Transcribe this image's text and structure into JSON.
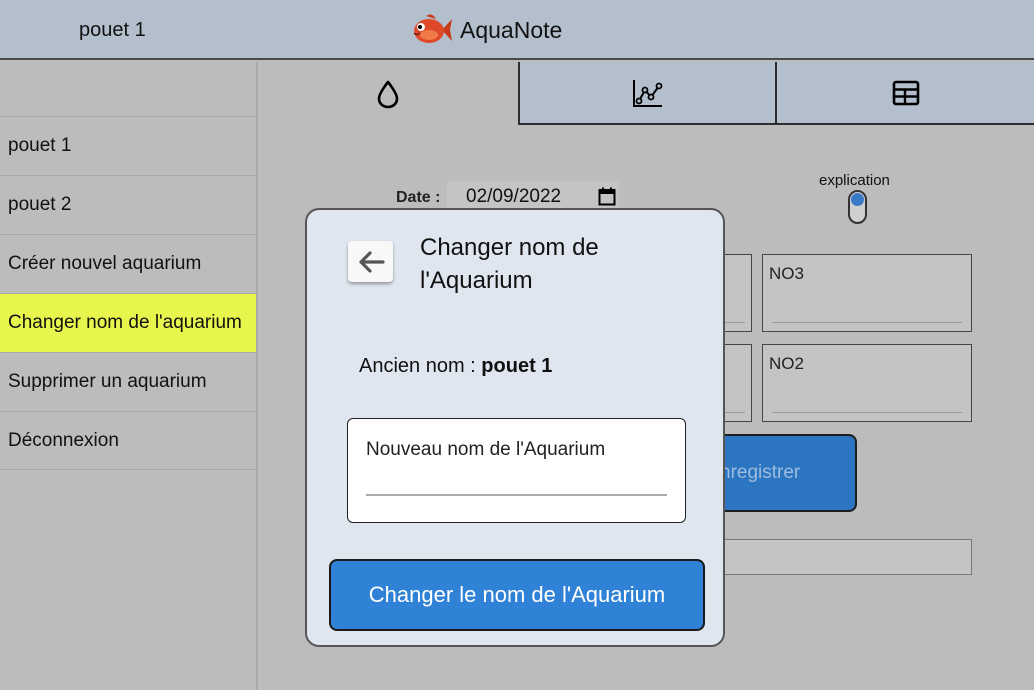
{
  "header": {
    "user": "pouet 1",
    "app_title": "AquaNote",
    "logo_icon": "fish-logo"
  },
  "sidebar": {
    "items": [
      {
        "label": "pouet 1"
      },
      {
        "label": "pouet 2"
      },
      {
        "label": "Créer nouvel aquarium"
      },
      {
        "label": "Changer nom de l'aquarium",
        "active": true
      },
      {
        "label": "Supprimer un aquarium"
      },
      {
        "label": "Déconnexion"
      }
    ]
  },
  "tabs": [
    {
      "icon": "water-drop-icon"
    },
    {
      "icon": "chart-icon"
    },
    {
      "icon": "table-icon"
    }
  ],
  "form": {
    "date_label": "Date :",
    "date_value": "02/09/2022",
    "explanation_label": "explication",
    "fields": [
      {
        "label": "NO3"
      },
      {
        "label": "NO2"
      }
    ],
    "save_label": "nregistrer"
  },
  "modal": {
    "title": "Changer nom de l'Aquarium",
    "old_name_label": "Ancien nom : ",
    "old_name_value": "pouet 1",
    "new_name_placeholder": "Nouveau nom de l'Aquarium",
    "submit_label": "Changer le nom de l'Aquarium"
  },
  "colors": {
    "header_bg": "#b3bfcc",
    "active_item": "#e8f54c",
    "primary": "#2f82d6",
    "modal_bg": "#dfe6ef"
  }
}
